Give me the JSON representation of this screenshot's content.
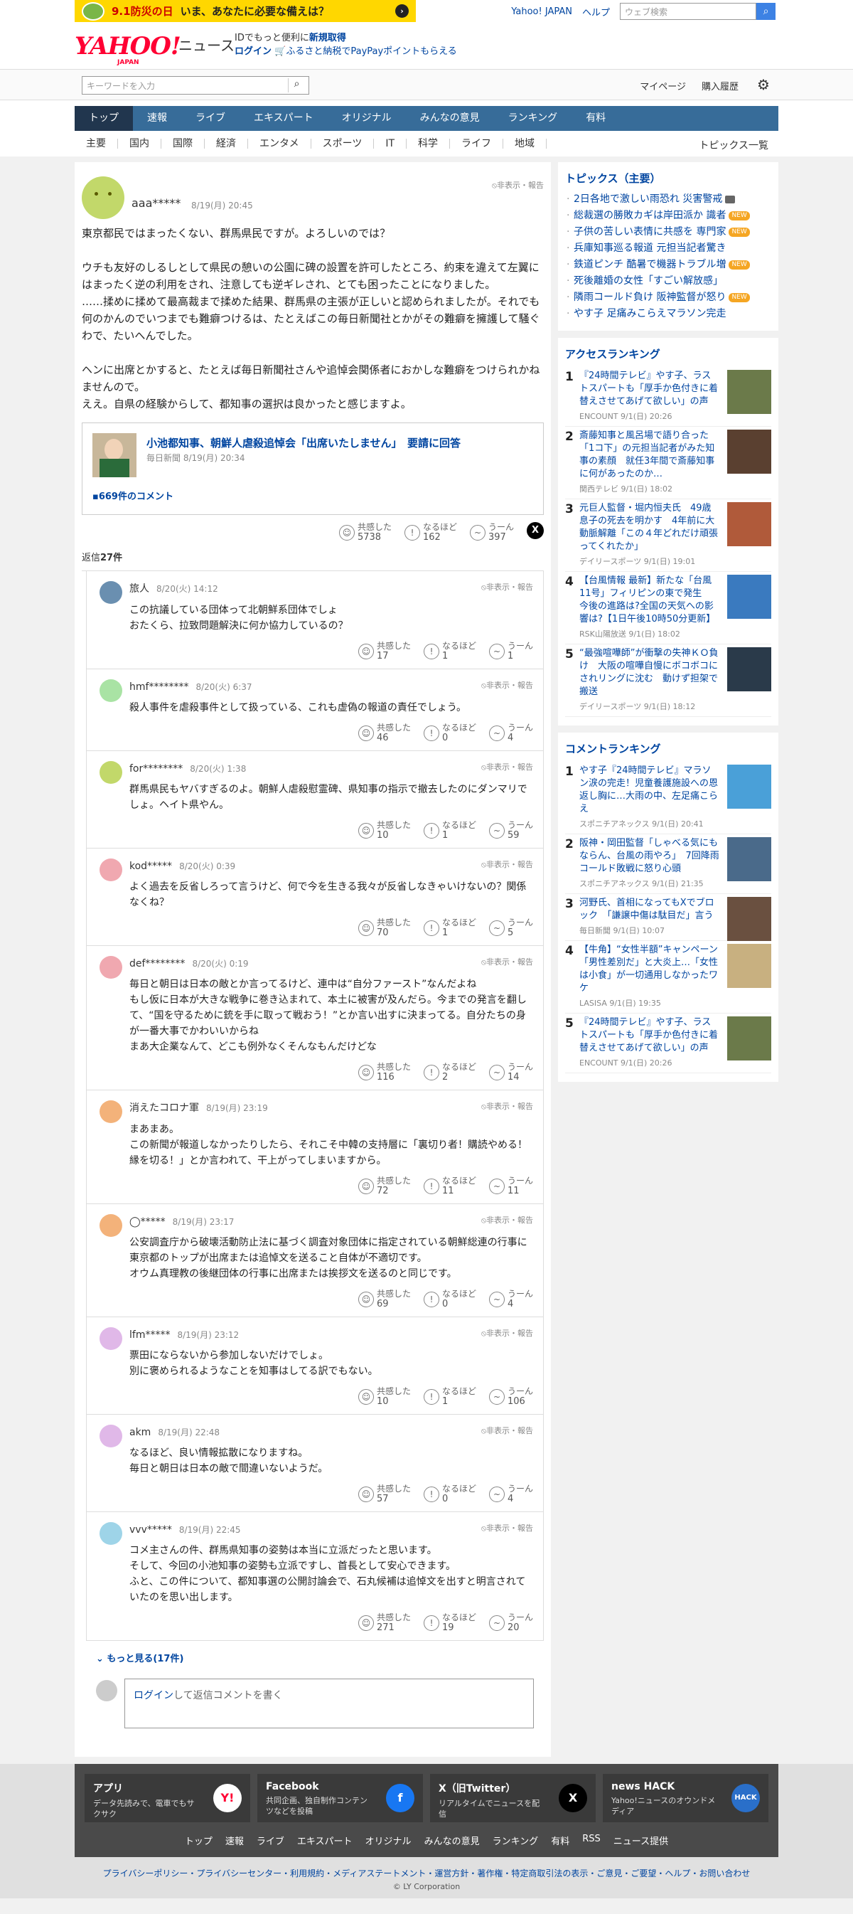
{
  "promo": {
    "date": "9.1防災の日",
    "text": "いま、あなたに必要な備えは？",
    "arrow": "›"
  },
  "toplinks": {
    "yahoo": "Yahoo! JAPAN",
    "help": "ヘルプ",
    "search_placeholder": "ウェブ検索",
    "search_icon": "search-icon"
  },
  "header": {
    "logo": "YAHOO!",
    "logo_sub": "JAPAN",
    "service": "ニュース",
    "id_line_prefix": "IDでもっと便利に",
    "id_line_link": "新規取得",
    "login": "ログイン",
    "furusato": "ふるさと納税でPayPayポイントもらえる"
  },
  "searchbar": {
    "placeholder": "キーワードを入力",
    "mypage": "マイページ",
    "history": "購入履歴"
  },
  "nav": [
    "トップ",
    "速報",
    "ライブ",
    "エキスパート",
    "オリジナル",
    "みんなの意見",
    "ランキング",
    "有料"
  ],
  "cats": [
    "主要",
    "国内",
    "国際",
    "経済",
    "エンタメ",
    "スポーツ",
    "IT",
    "科学",
    "ライフ",
    "地域"
  ],
  "topics_list_label": "トピックス一覧",
  "main_comment": {
    "user": "aaa*****",
    "date": "8/19(月) 20:45",
    "hide": "非表示・報告",
    "text": "東京都民ではまったくない、群馬県民ですが。よろしいのでは？\n\nウチも友好のしるしとして県民の憩いの公園に碑の設置を許可したところ、約束を違えて左翼にはまったく逆の利用をされ、注意しても逆ギレされ、とても困ったことになりました。\n……揉めに揉めて最高裁まで揉めた結果、群馬県の主張が正しいと認められましたが。それでも何のかんのでいつまでも難癖つけるは、たとえばこの毎日新聞社とかがその難癖を擁護して騒ぐわで、たいへんでした。\n\nヘンに出席とかすると、たとえば毎日新聞社さんや追悼会関係者におかしな難癖をつけられかねませんので。\nええ。自県の経験からして、都知事の選択は良かったと感じますよ。",
    "article": {
      "title": "小池都知事、朝鮮人虐殺追悼会「出席いたしません」　要請に回答",
      "meta": "毎日新聞 8/19(月) 20:34",
      "comments": "669件のコメント"
    },
    "reactions": {
      "agree_label": "共感した",
      "agree": "5738",
      "naruhodo_label": "なるほど",
      "naruhodo": "162",
      "uun_label": "うーん",
      "uun": "397"
    },
    "x_label": "X"
  },
  "reply_count_label": "返信",
  "reply_count": "27件",
  "replies": [
    {
      "user": "旅人",
      "date": "8/20(火) 14:12",
      "text": "この抗議している団体って北朝鮮系団体でしょ\nおたくら、拉致問題解決に何か協力しているの？",
      "agree": "17",
      "naruhodo": "1",
      "uun": "1",
      "color": "#6a8fb0"
    },
    {
      "user": "hmf********",
      "date": "8/20(火) 6:37",
      "text": "殺人事件を虐殺事件として扱っている、これも虚偽の報道の責任でしょう。",
      "agree": "46",
      "naruhodo": "0",
      "uun": "4",
      "color": "#a9e3a4"
    },
    {
      "user": "for********",
      "date": "8/20(火) 1:38",
      "text": "群馬県民もヤバすぎるのよ。朝鮮人虐殺慰霊碑、県知事の指示で撤去したのにダンマリでしょ。ヘイト県やん。",
      "agree": "10",
      "naruhodo": "1",
      "uun": "59",
      "color": "#c2d86a"
    },
    {
      "user": "kod*****",
      "date": "8/20(火) 0:39",
      "text": "よく過去を反省しろって言うけど、何で今を生きる我々が反省しなきゃいけないの？関係なくね？",
      "agree": "70",
      "naruhodo": "1",
      "uun": "5",
      "color": "#f0a8b0"
    },
    {
      "user": "def********",
      "date": "8/20(火) 0:19",
      "text": "毎日と朝日は日本の敵とか言ってるけど、連中は“自分ファースト”なんだよね\nもし仮に日本が大きな戦争に巻き込まれて、本土に被害が及んだら。今までの発言を翻して、“国を守るために銃を手に取って戦おう！”とか言い出すに決まってる。自分たちの身が一番大事でかわいいからね\nまあ大企業なんて、どこも例外なくそんなもんだけどな",
      "agree": "116",
      "naruhodo": "2",
      "uun": "14",
      "color": "#f0a8b0"
    },
    {
      "user": "消えたコロナ軍",
      "date": "8/19(月) 23:19",
      "text": "まあまあ。\nこの新聞が報道しなかったりしたら、それこそ中韓の支持層に「裏切り者！購読やめる！縁を切る！」とか言われて、干上がってしまいますから。",
      "agree": "72",
      "naruhodo": "11",
      "uun": "11",
      "color": "#f3b27a"
    },
    {
      "user": "◯*****",
      "date": "8/19(月) 23:17",
      "text": "公安調査庁から破壊活動防止法に基づく調査対象団体に指定されている朝鮮総連の行事に東京都のトップが出席または追悼文を送ること自体が不適切です。\nオウム真理教の後継団体の行事に出席または挨拶文を送るのと同じです。",
      "agree": "69",
      "naruhodo": "0",
      "uun": "4",
      "color": "#f3b27a"
    },
    {
      "user": "lfm*****",
      "date": "8/19(月) 23:12",
      "text": "票田にならないから参加しないだけでしょ。\n別に褒められるようなことを知事はしてる訳でもない。",
      "agree": "10",
      "naruhodo": "1",
      "uun": "106",
      "color": "#e0b8e8"
    },
    {
      "user": "akm",
      "date": "8/19(月) 22:48",
      "text": "なるほど、良い情報拡散になりますね。\n毎日と朝日は日本の敵で間違いないようだ。",
      "agree": "57",
      "naruhodo": "0",
      "uun": "4",
      "color": "#e0b8e8"
    },
    {
      "user": "vvv*****",
      "date": "8/19(月) 22:45",
      "text": "コメ主さんの件、群馬県知事の姿勢は本当に立派だったと思います。\nそして、今回の小池知事の姿勢も立派ですし、首長として安心できます。\nふと、この件について、都知事選の公開討論会で、石丸候補は追悼文を出すと明言されていたのを思い出します。",
      "agree": "271",
      "naruhodo": "19",
      "uun": "20",
      "color": "#9ed4e8"
    }
  ],
  "more": "もっと見る(17件)",
  "replybox": {
    "login": "ログイン",
    "text": "して返信コメントを書く"
  },
  "sidebar": {
    "topics_title": "トピックス（主要）",
    "topics": [
      {
        "t": "2日各地で激しい雨恐れ 災害警戒",
        "b": "video"
      },
      {
        "t": "総裁選の勝敗カギは岸田派か 識者",
        "b": "NEW"
      },
      {
        "t": "子供の苦しい表情に共感を 専門家",
        "b": "NEW"
      },
      {
        "t": "兵庫知事巡る報道 元担当記者驚き",
        "b": ""
      },
      {
        "t": "鉄道ピンチ 酷暑で機器トラブル増",
        "b": "NEW"
      },
      {
        "t": "死後離婚の女性「すごい解放感」",
        "b": ""
      },
      {
        "t": "隣雨コールド負け 阪神監督が怒り",
        "b": "NEW"
      },
      {
        "t": "やす子 足痛みこらえマラソン完走",
        "b": ""
      }
    ],
    "access_title": "アクセスランキング",
    "access": [
      {
        "n": "1",
        "t": "『24時間テレビ』やす子、ラストスパートも「厚手か色付きに着替えさせてあげて欲しい」の声",
        "s": "ENCOUNT 9/1(日) 20:26",
        "c": "#6b7a4a"
      },
      {
        "n": "2",
        "t": "斎藤知事と風呂場で語り合った「1コ下」の元担当記者がみた知事の素顔　就任3年間で斎藤知事に何があったのか…",
        "s": "関西テレビ 9/1(日) 18:02",
        "c": "#5a4030"
      },
      {
        "n": "3",
        "t": "元巨人監督・堀内恒夫氏　49歳息子の死去を明かす　4年前に大動脈解離「この４年どれだけ頑張ってくれたか」",
        "s": "デイリースポーツ 9/1(日) 19:01",
        "c": "#b05a3a"
      },
      {
        "n": "4",
        "t": "【台風情報 最新】新たな「台風11号」フィリピンの東で発生　今後の進路は?全国の天気への影響は?【1日午後10時50分更新】",
        "s": "RSK山陽放送 9/1(日) 18:02",
        "c": "#3a7abf"
      },
      {
        "n": "5",
        "t": "“最強喧嘩師”が衝撃の失神ＫＯ負け　大阪の喧嘩自慢にボコボコにされリングに沈む　動けず担架で搬送",
        "s": "デイリースポーツ 9/1(日) 18:12",
        "c": "#2a3a4a"
      }
    ],
    "comment_title": "コメントランキング",
    "comment": [
      {
        "n": "1",
        "t": "やす子『24時間テレビ』マラソン涙の完走！児童養護施設への恩返し胸に…大雨の中、左足痛こらえ",
        "s": "スポニチアネックス 9/1(日) 20:41",
        "c": "#4aa0d8"
      },
      {
        "n": "2",
        "t": "阪神・岡田監督「しゃべる気にもならん、台風の雨やろ」　7回降雨コールド敗戦に怒り心頭",
        "s": "スポニチアネックス 9/1(日) 21:35",
        "c": "#4a6a8a"
      },
      {
        "n": "3",
        "t": "河野氏、首相になってもXでブロック　「謙譲中傷は駄目だ」言う",
        "s": "毎日新聞 9/1(日) 10:07",
        "c": "#6a5040"
      },
      {
        "n": "4",
        "t": "【牛角】“女性半額”キャンペーン「男性差別だ」と大炎上…「女性は小食」が一切通用しなかったワケ",
        "s": "LASISA 9/1(日) 19:35",
        "c": "#c8b080"
      },
      {
        "n": "5",
        "t": "『24時間テレビ』やす子、ラストスパートも「厚手か色付きに着替えさせてあげて欲しい」の声",
        "s": "ENCOUNT 9/1(日) 20:26",
        "c": "#6b7a4a"
      }
    ]
  },
  "footer": {
    "apps": [
      {
        "h": "アプリ",
        "d": "データ先読みで、電車でもサクサク",
        "ic": "Y!",
        "bg": "#ffffff",
        "fg": "#ff0033"
      },
      {
        "h": "Facebook",
        "d": "共同企画、独自制作コンテンツなどを投稿",
        "ic": "f",
        "bg": "#1877f2",
        "fg": "#ffffff"
      },
      {
        "h": "X（旧Twitter）",
        "d": "リアルタイムでニュースを配信",
        "ic": "X",
        "bg": "#000000",
        "fg": "#ffffff"
      },
      {
        "h": "news HACK",
        "d": "Yahoo!ニュースのオウンドメディア",
        "ic": "HACK",
        "bg": "#2a6fc9",
        "fg": "#ffffff"
      }
    ],
    "links": [
      "トップ",
      "速報",
      "ライブ",
      "エキスパート",
      "オリジナル",
      "みんなの意見",
      "ランキング",
      "有料",
      "RSS",
      "ニュース提供"
    ],
    "legal": "プライバシーポリシー・プライバシーセンター・利用規約・メディアステートメント・運営方針・著作権・特定商取引法の表示・ご意見・ご要望・ヘルプ・お問い合わせ",
    "copy": "© LY Corporation"
  }
}
